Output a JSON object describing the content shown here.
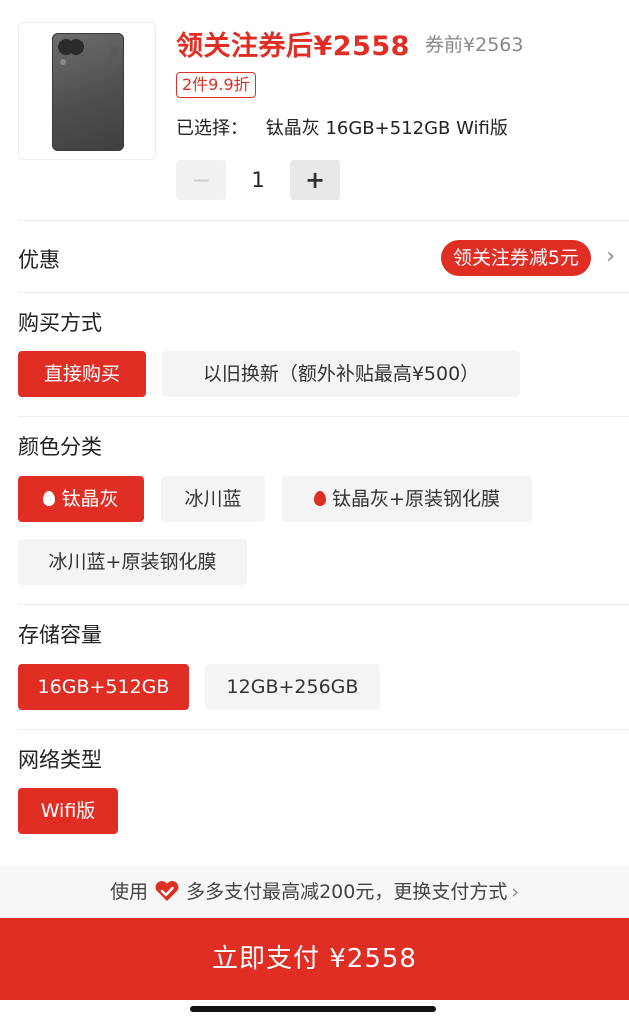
{
  "product": {
    "price_label": "领关注券后¥2558",
    "original_price": "券前¥2563",
    "discount_tag": "2件9.9折",
    "selected_label": "已选择：",
    "selected_value": "钛晶灰 16GB+512GB Wifi版",
    "quantity": "1",
    "minus": "−",
    "plus": "+"
  },
  "coupon": {
    "label": "优惠",
    "pill": "领关注券减5元",
    "chevron": "›"
  },
  "purchase_method": {
    "label": "购买方式",
    "options": [
      "直接购买",
      "以旧换新（额外补贴最高¥500）"
    ]
  },
  "color": {
    "label": "颜色分类",
    "options": [
      "钛晶灰",
      "冰川蓝",
      "钛晶灰+原装钢化膜",
      "冰川蓝+原装钢化膜"
    ]
  },
  "storage": {
    "label": "存储容量",
    "options": [
      "16GB+512GB",
      "12GB+256GB"
    ]
  },
  "network": {
    "label": "网络类型",
    "options": [
      "Wifi版"
    ]
  },
  "payment": {
    "hint_prefix": "使用",
    "hint_text": "多多支付最高减200元，更换支付方式",
    "chevron": "›",
    "button": "立即支付 ¥2558"
  },
  "colors": {
    "accent": "#e02e24",
    "option_bg": "#f4f4f4"
  }
}
